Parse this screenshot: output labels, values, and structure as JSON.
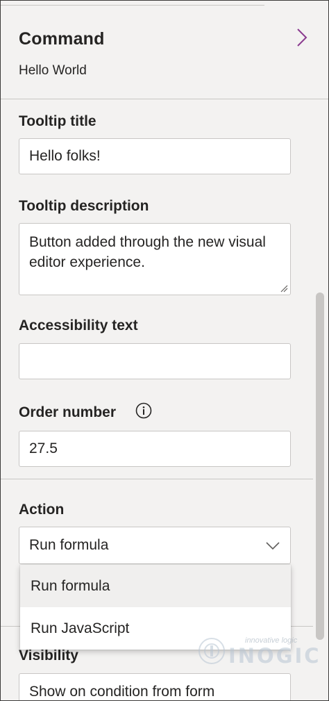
{
  "header": {
    "title": "Command",
    "subtitle": "Hello World"
  },
  "fields": {
    "tooltip_title": {
      "label": "Tooltip title",
      "value": "Hello folks!"
    },
    "tooltip_description": {
      "label": "Tooltip description",
      "value": "Button added through the new visual editor experience."
    },
    "accessibility_text": {
      "label": "Accessibility text",
      "value": ""
    },
    "order_number": {
      "label": "Order number",
      "value": "27.5"
    }
  },
  "action": {
    "label": "Action",
    "selected": "Run formula",
    "options": [
      "Run formula",
      "Run JavaScript"
    ]
  },
  "visibility": {
    "label": "Visibility",
    "selected": "Show on condition from form"
  },
  "watermark": {
    "tagline": "innovative logic",
    "brand": "INOGIC"
  },
  "icons": {
    "expand": "chevron-right-icon",
    "info": "info-icon",
    "dropdown": "chevron-down-icon",
    "resize": "resize-grip-icon"
  },
  "colors": {
    "accent_chevron": "#8a3b8f",
    "panel_bg": "#f3f2f1",
    "field_border": "#c8c6c4"
  }
}
